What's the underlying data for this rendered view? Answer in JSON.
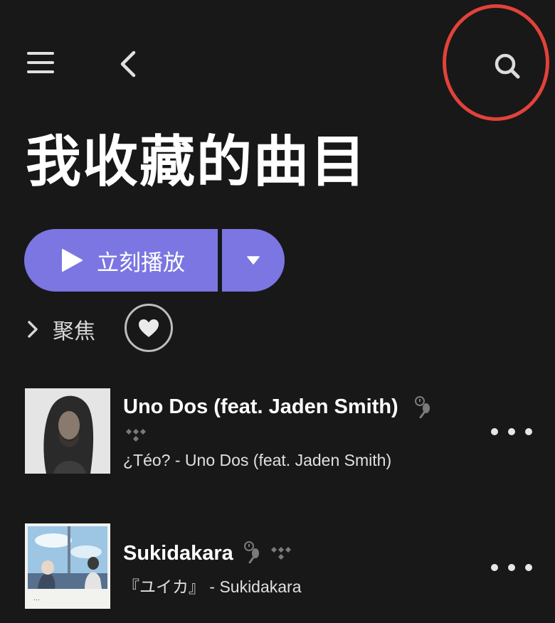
{
  "header": {
    "menu_icon": "hamburger-menu-icon",
    "back_icon": "chevron-left-icon",
    "search_icon": "search-icon"
  },
  "page": {
    "title": "我收藏的曲目"
  },
  "play": {
    "label": "立刻播放",
    "icon": "play-icon",
    "dropdown_icon": "caret-down-icon",
    "accent_color": "#7b76e2"
  },
  "focus": {
    "label": "聚焦",
    "icon": "chevron-right-icon"
  },
  "favorite": {
    "icon": "heart-icon"
  },
  "tracks": [
    {
      "title": "Uno Dos (feat. Jaden Smith)",
      "subtitle": "¿Téo? - Uno Dos (feat. Jaden Smith)",
      "badges": [
        "explicit-lyrics-icon",
        "tidal-icon"
      ]
    },
    {
      "title": "Sukidakara",
      "subtitle": "『ユイカ』 - Sukidakara",
      "badges": [
        "explicit-lyrics-icon",
        "tidal-icon"
      ]
    }
  ],
  "colors": {
    "background": "#181818",
    "annotation": "#e2423a"
  }
}
